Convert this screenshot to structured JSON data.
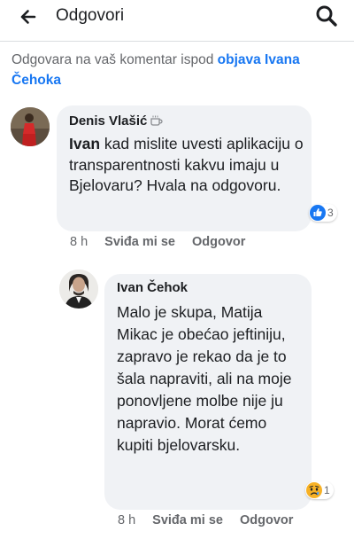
{
  "header": {
    "title": "Odgovori"
  },
  "context": {
    "prefix": "Odgovara na vaš komentar ispod",
    "link": "objava Ivana Čehoka"
  },
  "comments": [
    {
      "author": "Denis Vlašić",
      "author_badge_icon": "coffee-cup-icon",
      "tag": "Ivan",
      "text": "kad mislite uvesti aplikaciju o transparentnosti kakvu imaju u Bjelovaru? Hvala na odgovoru.",
      "reaction_icon": "like-icon",
      "reaction_count": "3",
      "time": "8 h",
      "like_label": "Sviđa mi se",
      "reply_label": "Odgovor"
    },
    {
      "author": "Ivan Čehok",
      "text": "Malo je skupa, Matija Mikac je obećao jeftiniju, zapravo je rekao da je to šala napraviti, ali na moje ponovljene molbe nije ju napravio. Morat ćemo kupiti bjelovarsku.",
      "reaction_icon": "sad-face-icon",
      "reaction_count": "1",
      "time": "8 h",
      "like_label": "Sviđa mi se",
      "reply_label": "Odgovor"
    }
  ],
  "colors": {
    "link_blue": "#1877f2",
    "bubble_bg": "#f0f2f5",
    "secondary_text": "#65676b"
  }
}
